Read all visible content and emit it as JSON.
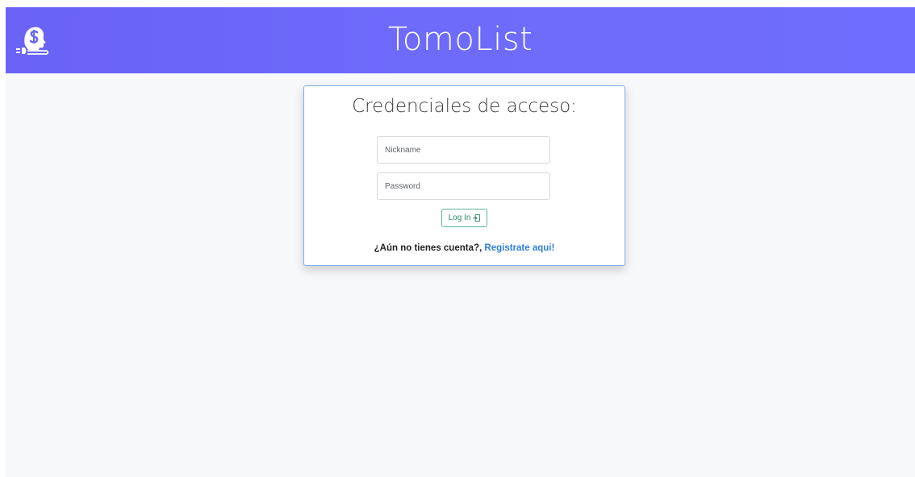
{
  "header": {
    "logo_icon": "head-speech-logo-icon",
    "title": "TomoList",
    "background_color": "#6b66f8"
  },
  "login_card": {
    "title": "Credenciales de acceso:",
    "nickname_placeholder": "Nickname",
    "nickname_value": "",
    "password_placeholder": "Password",
    "password_value": "",
    "login_button_label": "Log In",
    "login_button_icon": "login-arrow-icon",
    "register_prompt": "¿Aún no tienes cuenta?,",
    "register_link": "Registrate aqui!",
    "accent_color": "#2f7fd8",
    "button_color": "#2e8b66"
  }
}
